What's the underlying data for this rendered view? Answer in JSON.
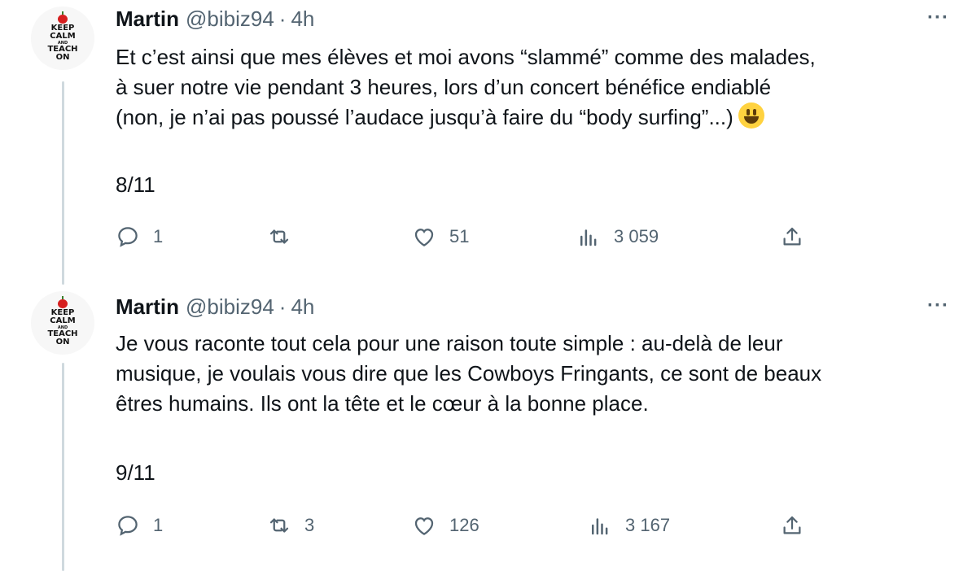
{
  "tweets": [
    {
      "avatar": {
        "lines": [
          "KEEP",
          "CALM",
          "AND",
          "TEACH",
          "ON"
        ]
      },
      "author": {
        "name": "Martin",
        "handle": "@bibiz94",
        "separator": "·",
        "time": "4h"
      },
      "more_label": "···",
      "text": "Et c’est ainsi que mes élèves et moi avons “slammé” comme des malades,\nà suer notre vie pendant 3 heures, lors d’un concert bénéfice endiablé\n(non, je n’ai pas poussé l’audace jusqu’à faire du “body surfing”...)",
      "emoji": "grinning-face",
      "thread_counter": "8/11",
      "actions": {
        "replies": "1",
        "retweets": "",
        "likes": "51",
        "views": "3 059"
      }
    },
    {
      "avatar": {
        "lines": [
          "KEEP",
          "CALM",
          "AND",
          "TEACH",
          "ON"
        ]
      },
      "author": {
        "name": "Martin",
        "handle": "@bibiz94",
        "separator": "·",
        "time": "4h"
      },
      "more_label": "···",
      "text": "Je vous raconte tout cela pour une raison toute simple : au-delà de leur\nmusique, je voulais vous dire que les Cowboys Fringants, ce sont de beaux\nêtres humains. Ils ont la tête et le cœur à la bonne place.",
      "thread_counter": "9/11",
      "actions": {
        "replies": "1",
        "retweets": "3",
        "likes": "126",
        "views": "3 167"
      }
    }
  ],
  "icons": {
    "reply": "speech-bubble-icon",
    "retweet": "retweet-arrows-icon",
    "like": "heart-icon",
    "views": "bar-chart-icon",
    "share": "share-upload-icon"
  },
  "colors": {
    "text": "#0f1419",
    "muted": "#536471",
    "thread_line": "#cfd9de",
    "emoji": "#ffd23f"
  }
}
